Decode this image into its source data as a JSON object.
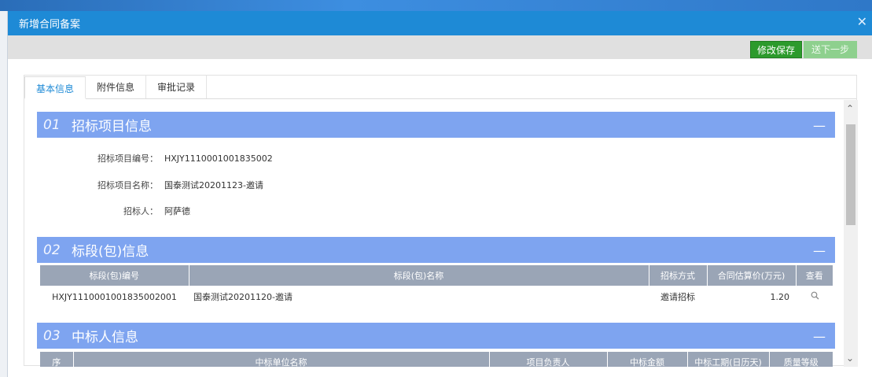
{
  "dialog": {
    "title": "新增合同备案",
    "close_icon": "close-icon"
  },
  "toolbar": {
    "save_label": "修改保存",
    "next_label": "送下一步"
  },
  "tabs": [
    {
      "label": "基本信息",
      "active": true
    },
    {
      "label": "附件信息",
      "active": false
    },
    {
      "label": "审批记录",
      "active": false
    }
  ],
  "sections": {
    "project": {
      "num": "01",
      "title": "招标项目信息",
      "fields": [
        {
          "label": "招标项目编号：",
          "value": "HXJY1110001001835002"
        },
        {
          "label": "招标项目名称：",
          "value": "国泰测试20201123-邀请"
        },
        {
          "label": "招标人：",
          "value": "阿萨德"
        }
      ]
    },
    "lot": {
      "num": "02",
      "title": "标段(包)信息",
      "headers": [
        "标段(包)编号",
        "标段(包)名称",
        "招标方式",
        "合同估算价(万元)",
        "查看"
      ],
      "rows": [
        {
          "code": "HXJY1110001001835002001",
          "name": "国泰测试20201120-邀请",
          "method": "邀请招标",
          "price": "1.20",
          "view_icon": "search-icon"
        }
      ]
    },
    "winner": {
      "num": "03",
      "title": "中标人信息",
      "headers": [
        "序",
        "中标单位名称",
        "项目负责人",
        "中标金额",
        "中标工期(日历天)",
        "质量等级"
      ]
    }
  },
  "colors": {
    "titlebar": "#1e8ad6",
    "section": "#7ea4f0",
    "save": "#2c9a2c",
    "next": "#8ed08e"
  }
}
